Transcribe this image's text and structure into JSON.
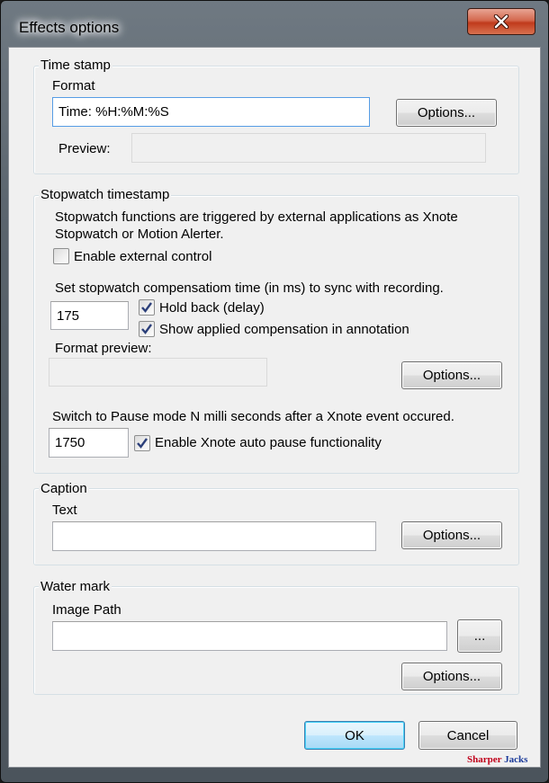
{
  "window": {
    "title": "Effects options"
  },
  "icons": {
    "close": "close-icon",
    "checkmark": "checkmark-icon"
  },
  "timestamp": {
    "group_label": "Time stamp",
    "format_label": "Format",
    "format_value": "Time: %H:%M:%S",
    "options_label": "Options...",
    "preview_label": "Preview:",
    "preview_value": ""
  },
  "stopwatch": {
    "group_label": "Stopwatch timestamp",
    "description_line1": "Stopwatch functions are triggered by external applications as Xnote",
    "description_line2": "Stopwatch or Motion Alerter.",
    "enable_external_label": "Enable external control",
    "enable_external_checked": false,
    "compensation_label": "Set stopwatch compensatiom time (in ms) to sync with recording.",
    "compensation_value": "175",
    "hold_back_label": "Hold back (delay)",
    "hold_back_checked": true,
    "show_compensation_label": "Show applied compensation in annotation",
    "show_compensation_checked": true,
    "format_preview_label": "Format preview:",
    "options_label": "Options...",
    "pause_label": "Switch to Pause mode N milli seconds after a Xnote event occured.",
    "pause_value": "1750",
    "auto_pause_label": "Enable Xnote auto pause functionality",
    "auto_pause_checked": true
  },
  "caption": {
    "group_label": "Caption",
    "text_label": "Text",
    "text_value": "",
    "options_label": "Options..."
  },
  "watermark": {
    "group_label": "Water mark",
    "image_path_label": "Image Path",
    "image_path_value": "",
    "browse_label": "...",
    "options_label": "Options..."
  },
  "footer": {
    "ok_label": "OK",
    "cancel_label": "Cancel",
    "brand_part1": "Sharper",
    "brand_part2": "Jacks",
    "brand_color1": "#c0001a",
    "brand_color2": "#1a3a9a"
  }
}
